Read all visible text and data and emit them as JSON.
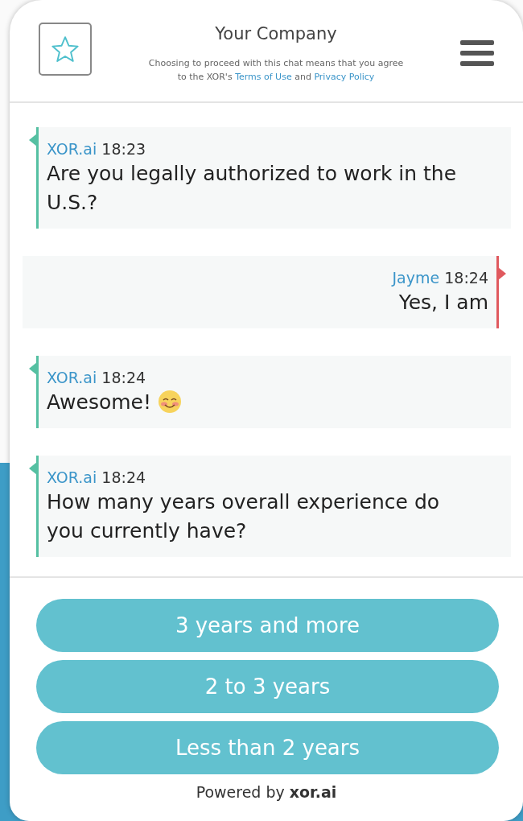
{
  "header": {
    "title": "Your Company",
    "disclaimer": {
      "before": "Choosing to proceed with this chat means that you agree to the XOR's",
      "terms_link": "Terms of Use",
      "middle": "and",
      "privacy_link": "Privacy Policy"
    }
  },
  "messages": [
    {
      "kind": "bot",
      "sender": "XOR.ai",
      "time": "18:23",
      "text": "Are you legally authorized to work in the U.S.?",
      "emoji": false
    },
    {
      "kind": "user",
      "sender": "Jayme",
      "time": "18:24",
      "text": "Yes, I am",
      "emoji": false
    },
    {
      "kind": "bot",
      "sender": "XOR.ai",
      "time": "18:24",
      "text": "Awesome!",
      "emoji": true
    },
    {
      "kind": "bot",
      "sender": "XOR.ai",
      "time": "18:24",
      "text": "How many years overall experience do you currently have?",
      "emoji": false
    }
  ],
  "options": [
    "3 years and more",
    "2 to 3 years",
    "Less than 2 years"
  ],
  "footer": "Powered by **xor.ai**"
}
